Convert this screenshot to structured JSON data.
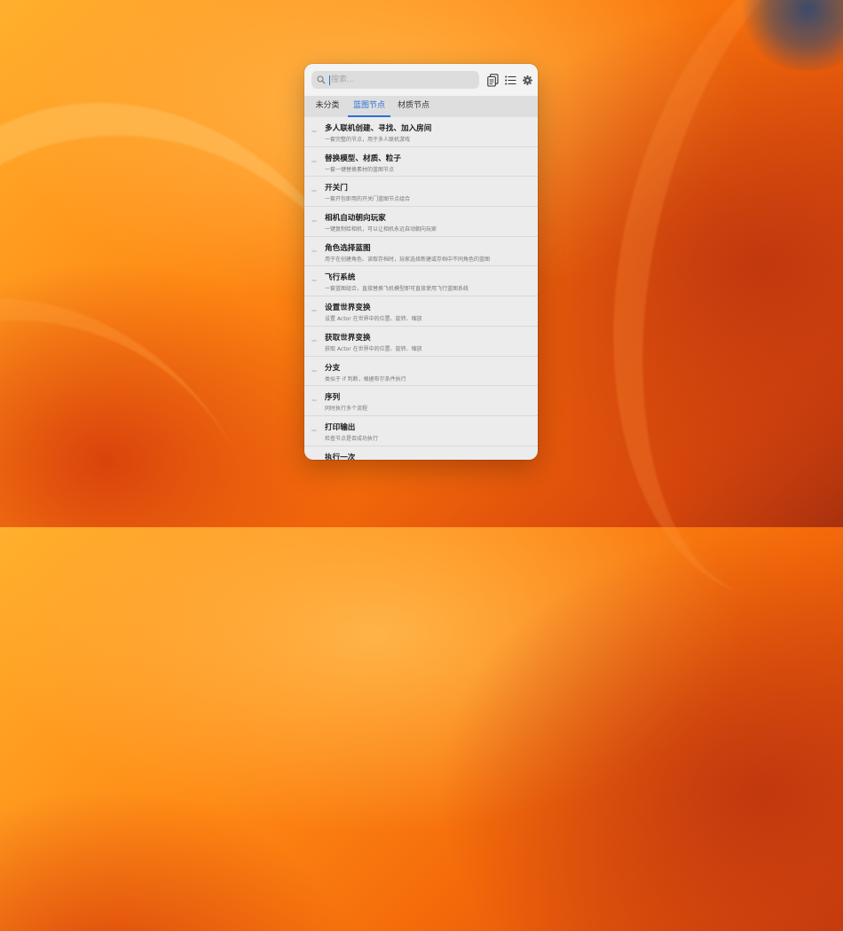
{
  "toolbar": {
    "search_placeholder": "搜索...",
    "icons": [
      "search-icon",
      "copy-icon",
      "list-icon",
      "gear-icon"
    ]
  },
  "tabs": [
    {
      "label": "未分类",
      "active": false
    },
    {
      "label": "蓝图节点",
      "active": true
    },
    {
      "label": "材质节点",
      "active": false
    }
  ],
  "items": [
    {
      "title": "多人联机创建、寻找、加入房间",
      "desc": "一套完整的节点，用于多人联机游戏"
    },
    {
      "title": "替换模型、材质、粒子",
      "desc": "一套一键替换素材的蓝图节点"
    },
    {
      "title": "开关门",
      "desc": "一套开包即用的开关门蓝图节点组合"
    },
    {
      "title": "相机自动朝向玩家",
      "desc": "一键复制给相机，可以让相机永远自动朝向玩家"
    },
    {
      "title": "角色选择蓝图",
      "desc": "用于在创建角色、读取存档时，玩家选择新建或存档中不同角色的蓝图"
    },
    {
      "title": "飞行系统",
      "desc": "一套蓝图组合，直接替换飞机模型即可直接使用飞行蓝图系统"
    },
    {
      "title": "设置世界变换",
      "desc": "设置 Actor 在世界中的位置、旋转、缩放"
    },
    {
      "title": "获取世界变换",
      "desc": "获取 Actor 在世界中的位置、旋转、缩放"
    },
    {
      "title": "分支",
      "desc": "类似于 if 判断，根据布尔条件执行"
    },
    {
      "title": "序列",
      "desc": "同时执行多个流程"
    },
    {
      "title": "打印输出",
      "desc": "检查节点是否成功执行"
    },
    {
      "title": "执行一次",
      "desc": ""
    }
  ],
  "colors": {
    "accent": "#2a6fd6",
    "panel_bg": "#ececec"
  }
}
